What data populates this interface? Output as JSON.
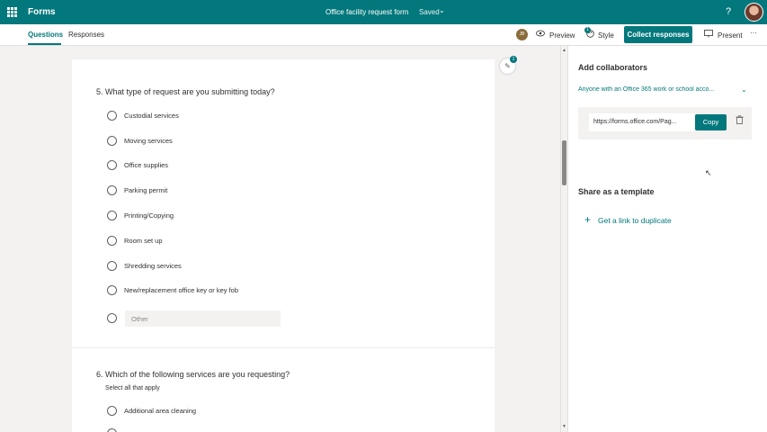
{
  "header": {
    "app_name": "Forms",
    "form_title": "Office facility request form",
    "saved_status": "Saved",
    "help": "?"
  },
  "toolbar": {
    "tabs": [
      "Questions",
      "Responses"
    ],
    "coauthor_initials": "JB",
    "preview_label": "Preview",
    "style_label": "Style",
    "style_badge": "1",
    "collect_label": "Collect responses",
    "present_label": "Present",
    "more": "···"
  },
  "questions": [
    {
      "title": "5. What type of request are you submitting today?",
      "options": [
        "Custodial services",
        "Moving services",
        "Office supplies",
        "Parking permit",
        "Printing/Copying",
        "Room set up",
        "Shredding services",
        "New/replacement office key or key fob"
      ],
      "other_placeholder": "Other"
    },
    {
      "title": "6. Which of the following services are you requesting?",
      "subtitle": "Select all that apply",
      "options": [
        "Additional area cleaning"
      ]
    }
  ],
  "floating_badge": "1",
  "share_panel": {
    "collaborators_heading": "Add collaborators",
    "permission": "Anyone with an Office 365 work or school acco...",
    "link": "https://forms.office.com/Pag...",
    "copy_label": "Copy",
    "template_heading": "Share as a template",
    "duplicate_link": "Get a link to duplicate"
  },
  "colors": {
    "accent": "#03787c",
    "background": "#f3f2f1"
  }
}
